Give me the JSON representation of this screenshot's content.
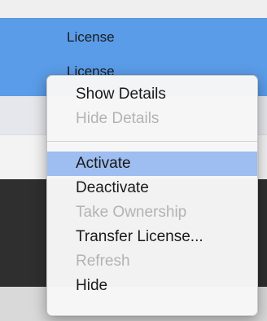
{
  "list": {
    "selected_row": {
      "line1": "License",
      "line2": "License"
    }
  },
  "context_menu": {
    "group1": [
      {
        "label": "Show Details",
        "enabled": true
      },
      {
        "label": "Hide Details",
        "enabled": false
      }
    ],
    "group2": [
      {
        "label": "Activate",
        "enabled": true,
        "highlighted": true
      },
      {
        "label": "Deactivate",
        "enabled": true
      },
      {
        "label": "Take Ownership",
        "enabled": false
      },
      {
        "label": "Transfer License...",
        "enabled": true
      },
      {
        "label": "Refresh",
        "enabled": false
      },
      {
        "label": "Hide",
        "enabled": true
      }
    ]
  },
  "colors": {
    "selection_blue": "#5a9ce8",
    "menu_highlight": "#9ebdf0",
    "disabled_text": "#b3b3b3"
  }
}
